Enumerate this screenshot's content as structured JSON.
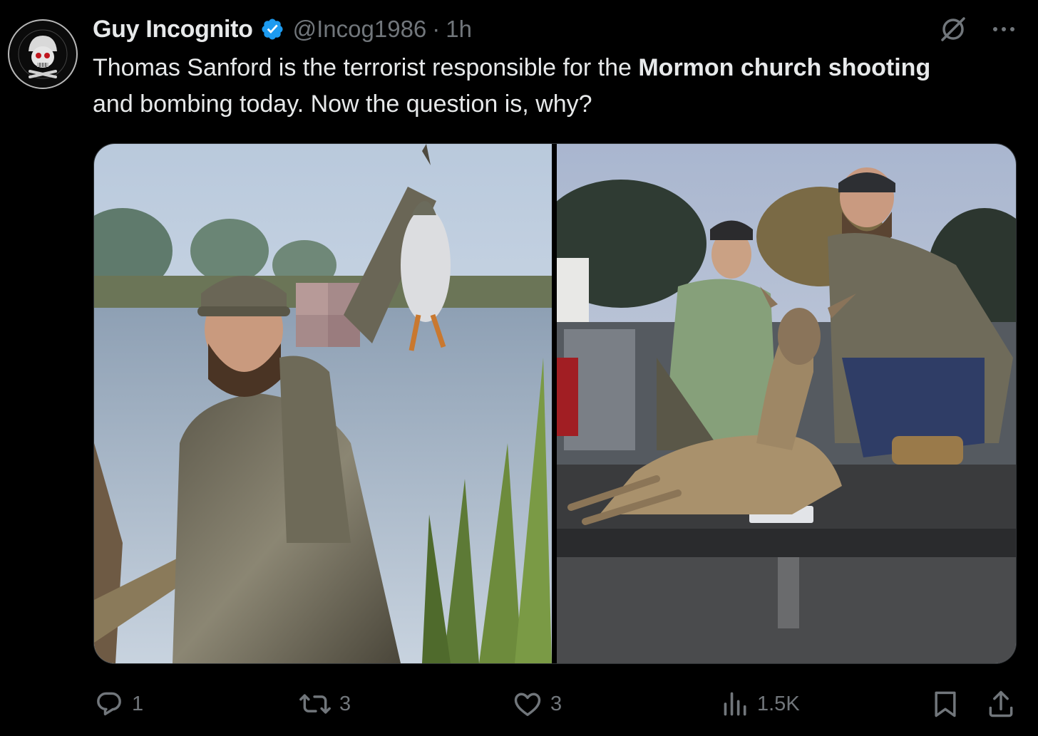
{
  "author": {
    "display_name": "Guy Incognito",
    "handle": "@Incog1986",
    "separator": "·",
    "time": "1h",
    "verified_icon": "verified-badge-icon",
    "avatar_icon": "skull-helmet-logo"
  },
  "tweet": {
    "text_1": "Thomas Sanford is the terrorist responsible for the ",
    "text_bold_1": "Mormon church shooting",
    "text_2": " and bombing today. Now the question is, why?"
  },
  "media": {
    "photos": [
      {
        "name": "photo-hunter-with-duck"
      },
      {
        "name": "photo-deer-on-truck"
      }
    ]
  },
  "actions": {
    "replies": "1",
    "reposts": "3",
    "likes": "3",
    "views": "1.5K"
  },
  "colors": {
    "background": "#000000",
    "text": "#e7e9ea",
    "muted": "#71767b",
    "verified": "#1d9bf0",
    "border": "#2f3336"
  }
}
